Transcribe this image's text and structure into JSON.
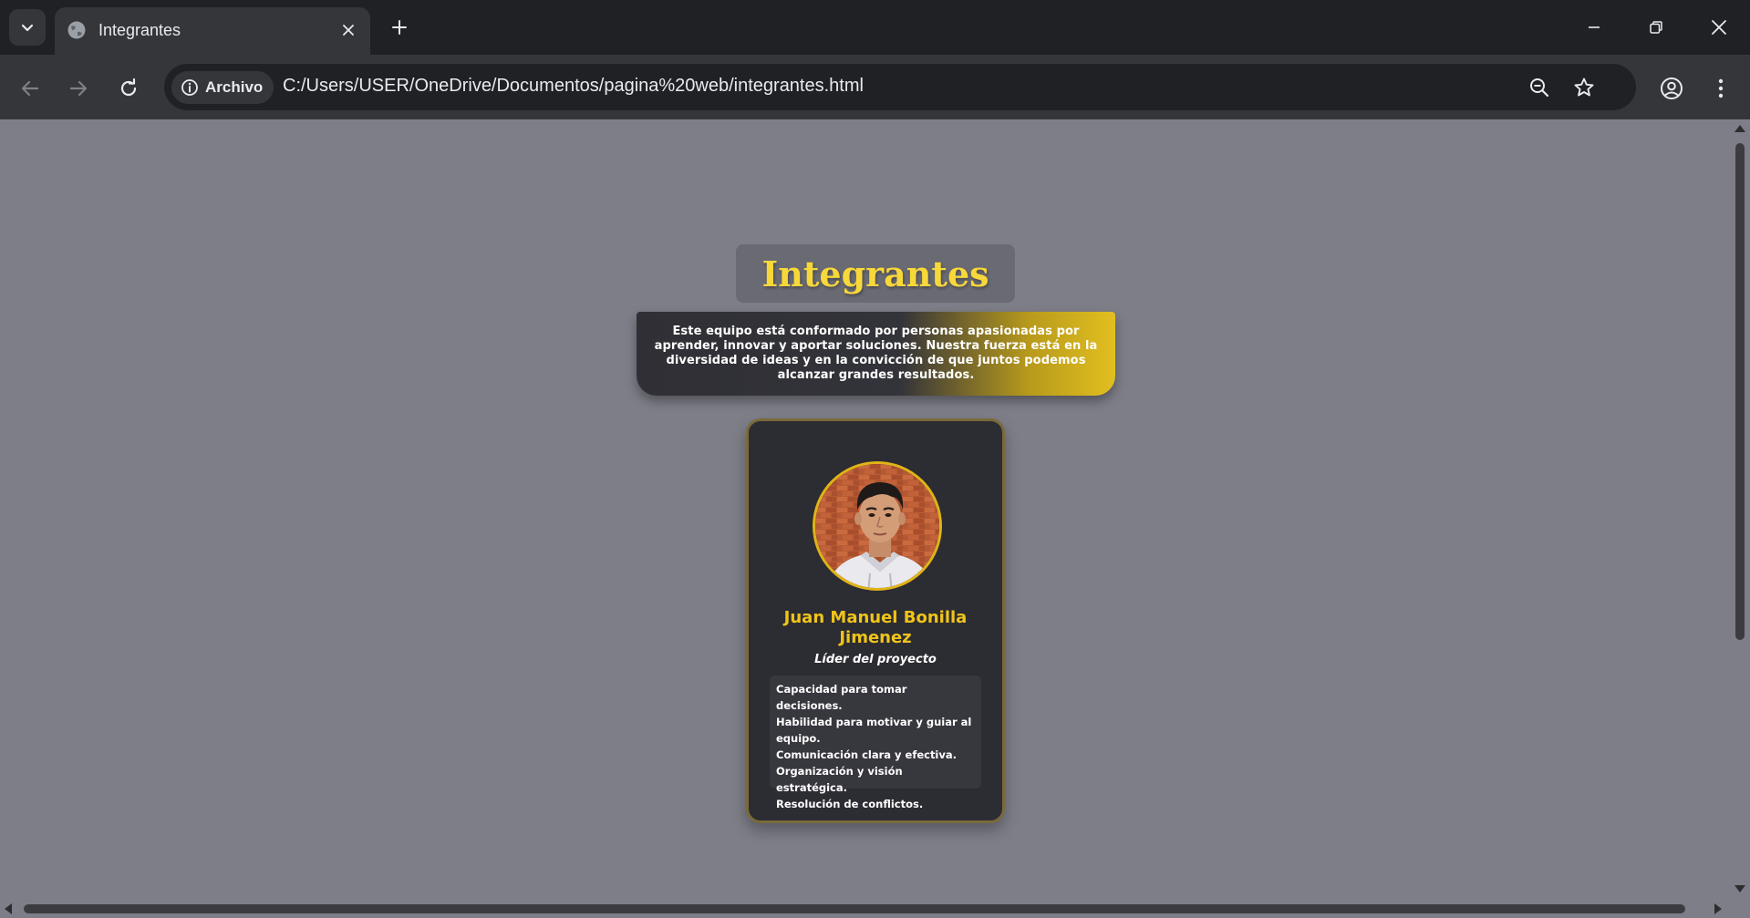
{
  "browser": {
    "tab": {
      "title": "Integrantes",
      "favicon": "globe-icon"
    },
    "omnibox": {
      "chip_label": "Archivo",
      "url": "C:/Users/USER/OneDrive/Documentos/pagina%20web/integrantes.html"
    },
    "icons": {
      "tab_search": "chevron-down-icon",
      "close_tab": "close-icon",
      "new_tab": "plus-icon",
      "minimize": "minimize-icon",
      "restore": "restore-icon",
      "close_window": "close-icon",
      "back": "back-arrow-icon",
      "forward": "forward-arrow-icon",
      "reload": "reload-icon",
      "site_info": "info-icon",
      "zoom": "zoom-out-icon",
      "bookmark": "star-icon",
      "profile": "profile-icon",
      "menu": "kebab-menu-icon"
    }
  },
  "page": {
    "title": "Integrantes",
    "intro": "Este equipo está conformado por personas apasionadas por aprender, innovar y aportar soluciones. Nuestra fuerza está en la diversidad de ideas y en la convicción de que juntos podemos alcanzar grandes resultados.",
    "members": [
      {
        "name": "Juan Manuel Bonilla Jimenez",
        "role": "Líder del proyecto",
        "skills": [
          "Capacidad para tomar decisiones.",
          "Habilidad para motivar y guiar al equipo.",
          "Comunicación clara y efectiva.",
          "Organización y visión estratégica.",
          "Resolución de conflictos."
        ]
      }
    ]
  },
  "colors": {
    "page_background": "#7e7e88",
    "accent_gold": "#f0c419",
    "card_background": "#2c2c33",
    "title_text": "#f7d83a"
  }
}
